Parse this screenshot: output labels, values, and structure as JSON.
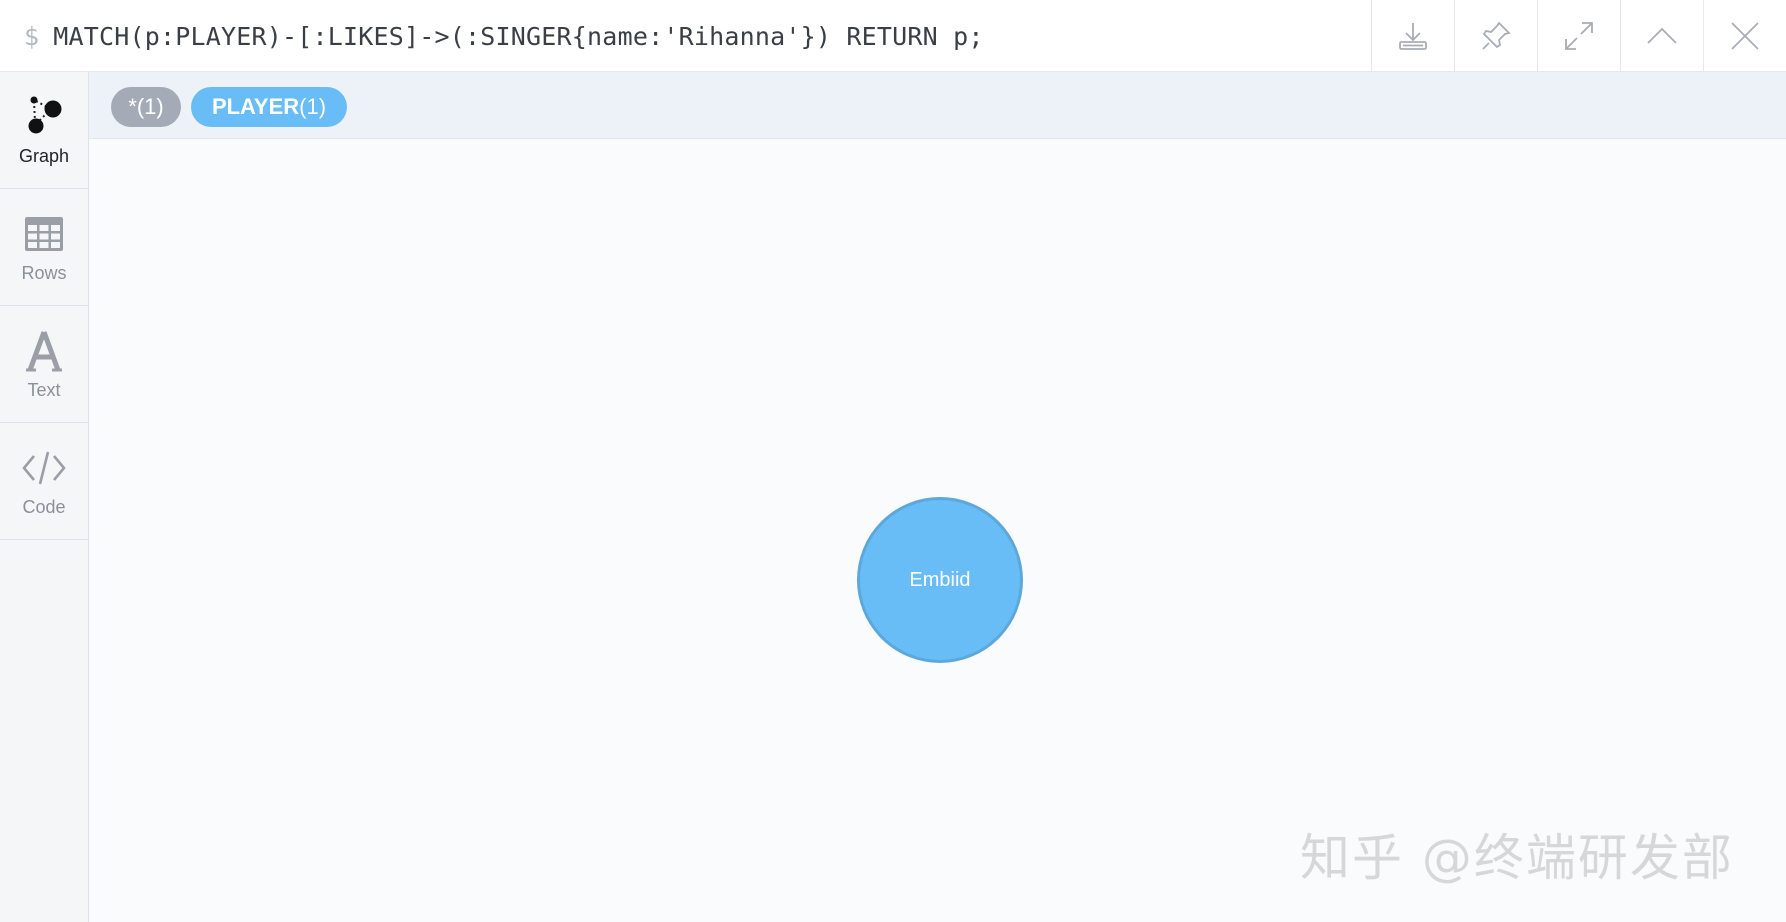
{
  "query": {
    "prompt": "$",
    "text": "MATCH(p:PLAYER)-[:LIKES]->(:SINGER{name:'Rihanna'}) RETURN p;"
  },
  "toolbar": {
    "icons": [
      "download-icon",
      "pin-icon",
      "expand-icon",
      "collapse-up-icon",
      "close-icon"
    ]
  },
  "sidebar": {
    "items": [
      {
        "label": "Graph",
        "icon": "graph-icon",
        "active": true
      },
      {
        "label": "Rows",
        "icon": "table-icon",
        "active": false
      },
      {
        "label": "Text",
        "icon": "text-icon",
        "active": false
      },
      {
        "label": "Code",
        "icon": "code-icon",
        "active": false
      }
    ]
  },
  "filters": {
    "all": {
      "label": "*",
      "count": "(1)"
    },
    "player": {
      "label": "PLAYER",
      "count": "(1)"
    }
  },
  "graph": {
    "nodes": [
      {
        "label": "Embiid",
        "color": "#68bdf6"
      }
    ]
  },
  "watermark": {
    "text": "知乎 @终端研发部"
  },
  "colors": {
    "accent": "#68bdf6",
    "pill_gray": "#a5abb6"
  }
}
